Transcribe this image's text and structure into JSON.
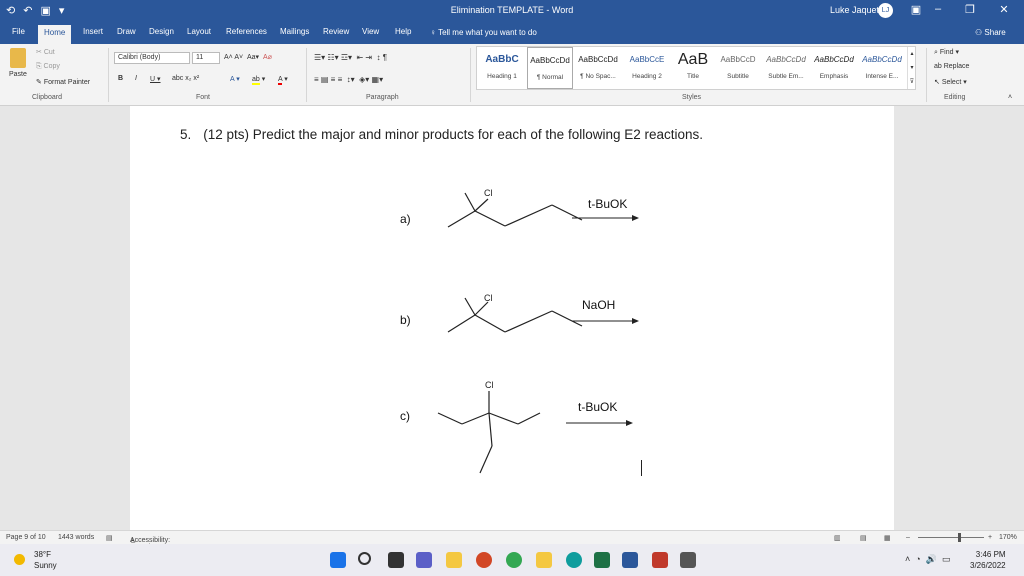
{
  "titlebar": {
    "doc_title": "Elimination TEMPLATE - Word",
    "user_name": "Luke Jaquet",
    "user_initials": "LJ"
  },
  "tabs": [
    "File",
    "Home",
    "Insert",
    "Draw",
    "Design",
    "Layout",
    "References",
    "Mailings",
    "Review",
    "View",
    "Help"
  ],
  "tell_me": "Tell me what you want to do",
  "share_label": "Share",
  "ribbon": {
    "clipboard": {
      "cut": "Cut",
      "copy": "Copy",
      "paste": "Paste",
      "format_painter": "Format Painter",
      "label": "Clipboard"
    },
    "font": {
      "name": "Calibri (Body)",
      "size": "11",
      "label": "Font"
    },
    "paragraph": {
      "label": "Paragraph"
    },
    "styles": {
      "label": "Styles",
      "items": [
        {
          "sample": "AaBbC",
          "name": "Heading 1"
        },
        {
          "sample": "AaBbCcDd",
          "name": "¶ Normal"
        },
        {
          "sample": "AaBbCcDd",
          "name": "¶ No Spac..."
        },
        {
          "sample": "AaBbCcE",
          "name": "Heading 2"
        },
        {
          "sample": "AaB",
          "name": "Title"
        },
        {
          "sample": "AaBbCcD",
          "name": "Subtitle"
        },
        {
          "sample": "AaBbCcDd",
          "name": "Subtle Em..."
        },
        {
          "sample": "AaBbCcDd",
          "name": "Emphasis"
        },
        {
          "sample": "AaBbCcDd",
          "name": "Intense E..."
        }
      ]
    },
    "editing": {
      "find": "Find",
      "replace": "Replace",
      "select": "Select",
      "label": "Editing"
    }
  },
  "document": {
    "question_number": "5.",
    "question_text": "(12 pts) Predict the major and minor products for each of the following E2 reactions.",
    "parts": [
      {
        "label": "a)",
        "reagent": "t-BuOK",
        "halogen": "Cl"
      },
      {
        "label": "b)",
        "reagent": "NaOH",
        "halogen": "Cl"
      },
      {
        "label": "c)",
        "reagent": "t-BuOK",
        "halogen": "Cl"
      }
    ]
  },
  "statusbar": {
    "page": "Page 9 of 10",
    "words": "1443 words",
    "accessibility": "Accessibility: Investigate",
    "zoom": "170%"
  },
  "taskbar": {
    "temperature": "38°F",
    "condition": "Sunny",
    "time": "3:46 PM",
    "date": "3/26/2022"
  },
  "colors": {
    "word_blue": "#2b579a",
    "ribbon_bg": "#f3f3f3"
  }
}
